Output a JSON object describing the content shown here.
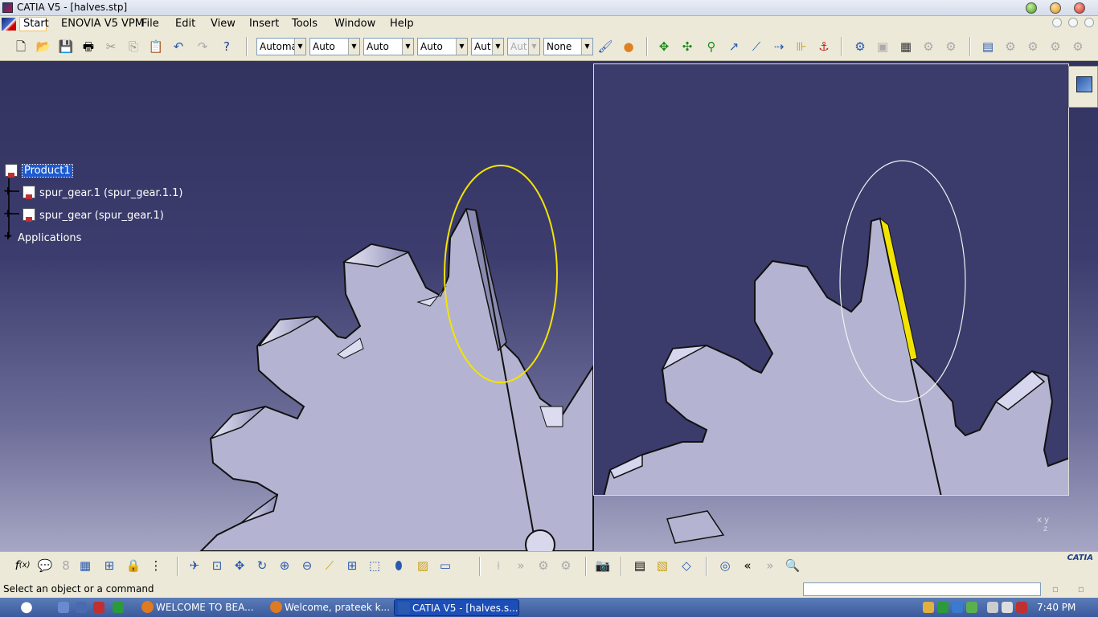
{
  "window": {
    "title": "CATIA V5 - [halves.stp]"
  },
  "menu": {
    "items": [
      "Start",
      "ENOVIA V5 VPM",
      "File",
      "Edit",
      "View",
      "Insert",
      "Tools",
      "Window",
      "Help"
    ]
  },
  "toolbar": {
    "combos": [
      {
        "value": "Automa",
        "enabled": true
      },
      {
        "value": "Auto",
        "enabled": true
      },
      {
        "value": "Auto",
        "enabled": true
      },
      {
        "value": "Auto",
        "enabled": true
      },
      {
        "value": "Aut",
        "enabled": true
      },
      {
        "value": "Aut",
        "enabled": false
      },
      {
        "value": "None",
        "enabled": true
      }
    ]
  },
  "tree": {
    "root": "Product1",
    "children": [
      "spur_gear.1 (spur_gear.1.1)",
      "spur_gear (spur_gear.1)"
    ],
    "applications": "Applications"
  },
  "axes_label": {
    "x": "x",
    "y": "y",
    "z": "z"
  },
  "bottom_logo": "CATIA",
  "status": {
    "message": "Select an object or a command"
  },
  "taskbar": {
    "buttons": [
      {
        "label": "WELCOME TO BEA...",
        "active": false
      },
      {
        "label": "Welcome, prateek k...",
        "active": false
      },
      {
        "label": "CATIA V5 - [halves.s...",
        "active": true
      }
    ],
    "clock": "7:40 PM"
  },
  "colors": {
    "highlight": "#f2e400",
    "selection": "#1c5ad0",
    "gear_face": "#b4b4d2"
  }
}
